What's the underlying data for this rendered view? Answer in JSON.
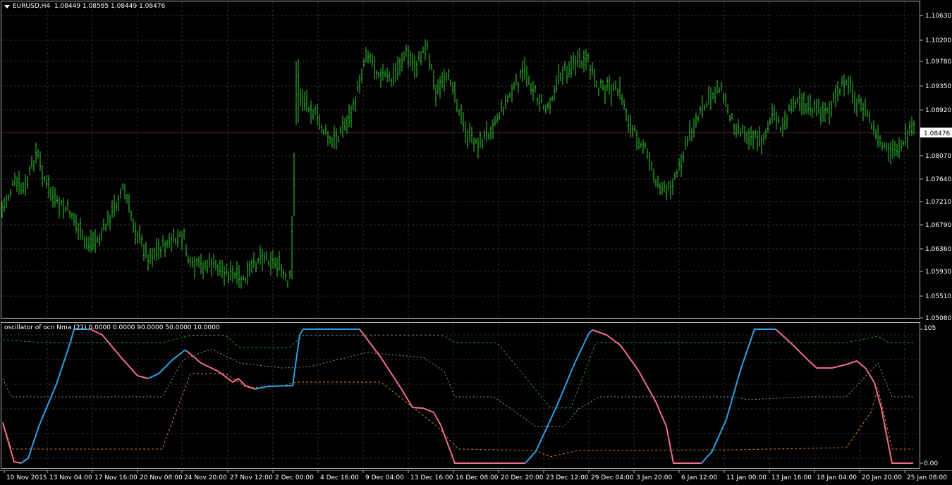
{
  "main_chart": {
    "title": "EURUSD,H4  1.08449 1.08585 1.08449 1.08476",
    "price_labels": [
      "1.10630",
      "1.10200",
      "1.09780",
      "1.09350",
      "1.08920",
      "1.08476",
      "1.08070",
      "1.07640",
      "1.07210",
      "1.06790",
      "1.06360",
      "1.05930",
      "1.05510",
      "1.05080"
    ],
    "current_price": "1.08476",
    "bar_color": "#32cd32",
    "price_line_color": "#7a1a4a"
  },
  "oscillator": {
    "title": "oscillator of ocn Nma (21) 0.0000 0.0000 90.0000 50.0000 10.0000",
    "labels": [
      "105",
      "0.00"
    ],
    "up_color": "#29a3e6",
    "down_color": "#ee6e8e",
    "upper_band_color": "#2e9a2e",
    "lower_band_color": "#d18a1a"
  },
  "time_axis": [
    "10 Nov 2015",
    "13 Nov 04:00",
    "17 Nov 16:00",
    "20 Nov 08:00",
    "24 Nov 20:00",
    "27 Nov 12:00",
    "2 Dec 00:00",
    "4 Dec 16:00",
    "9 Dec 04:00",
    "13 Dec 16:00",
    "16 Dec 08:00",
    "20 Dec 20:00",
    "23 Dec 12:00",
    "29 Dec 04:00",
    "3 Jan 20:00",
    "6 Jan 12:00",
    "11 Jan 00:00",
    "13 Jan 16:00",
    "18 Jan 04:00",
    "20 Jan 20:00",
    "25 Jan 08:00"
  ],
  "chart_data": {
    "type": "line",
    "title": "EURUSD,H4",
    "series": [
      {
        "name": "EURUSD",
        "x": [
          "10 Nov 2015",
          "13 Nov 04:00",
          "17 Nov 16:00",
          "20 Nov 08:00",
          "24 Nov 20:00",
          "27 Nov 12:00",
          "2 Dec 00:00",
          "4 Dec 16:00",
          "9 Dec 04:00",
          "13 Dec 16:00",
          "16 Dec 08:00",
          "20 Dec 20:00",
          "23 Dec 12:00",
          "29 Dec 04:00",
          "3 Jan 20:00",
          "6 Jan 12:00",
          "11 Jan 00:00",
          "13 Jan 16:00",
          "18 Jan 04:00",
          "20 Jan 20:00",
          "25 Jan 08:00"
        ],
        "values": [
          1.074,
          1.072,
          1.068,
          1.064,
          1.066,
          1.06,
          1.058,
          1.087,
          1.094,
          1.098,
          1.087,
          1.086,
          1.094,
          1.094,
          1.075,
          1.082,
          1.09,
          1.092,
          1.089,
          1.08,
          1.085
        ]
      }
    ],
    "ylim": [
      1.0508,
      1.1063
    ]
  }
}
